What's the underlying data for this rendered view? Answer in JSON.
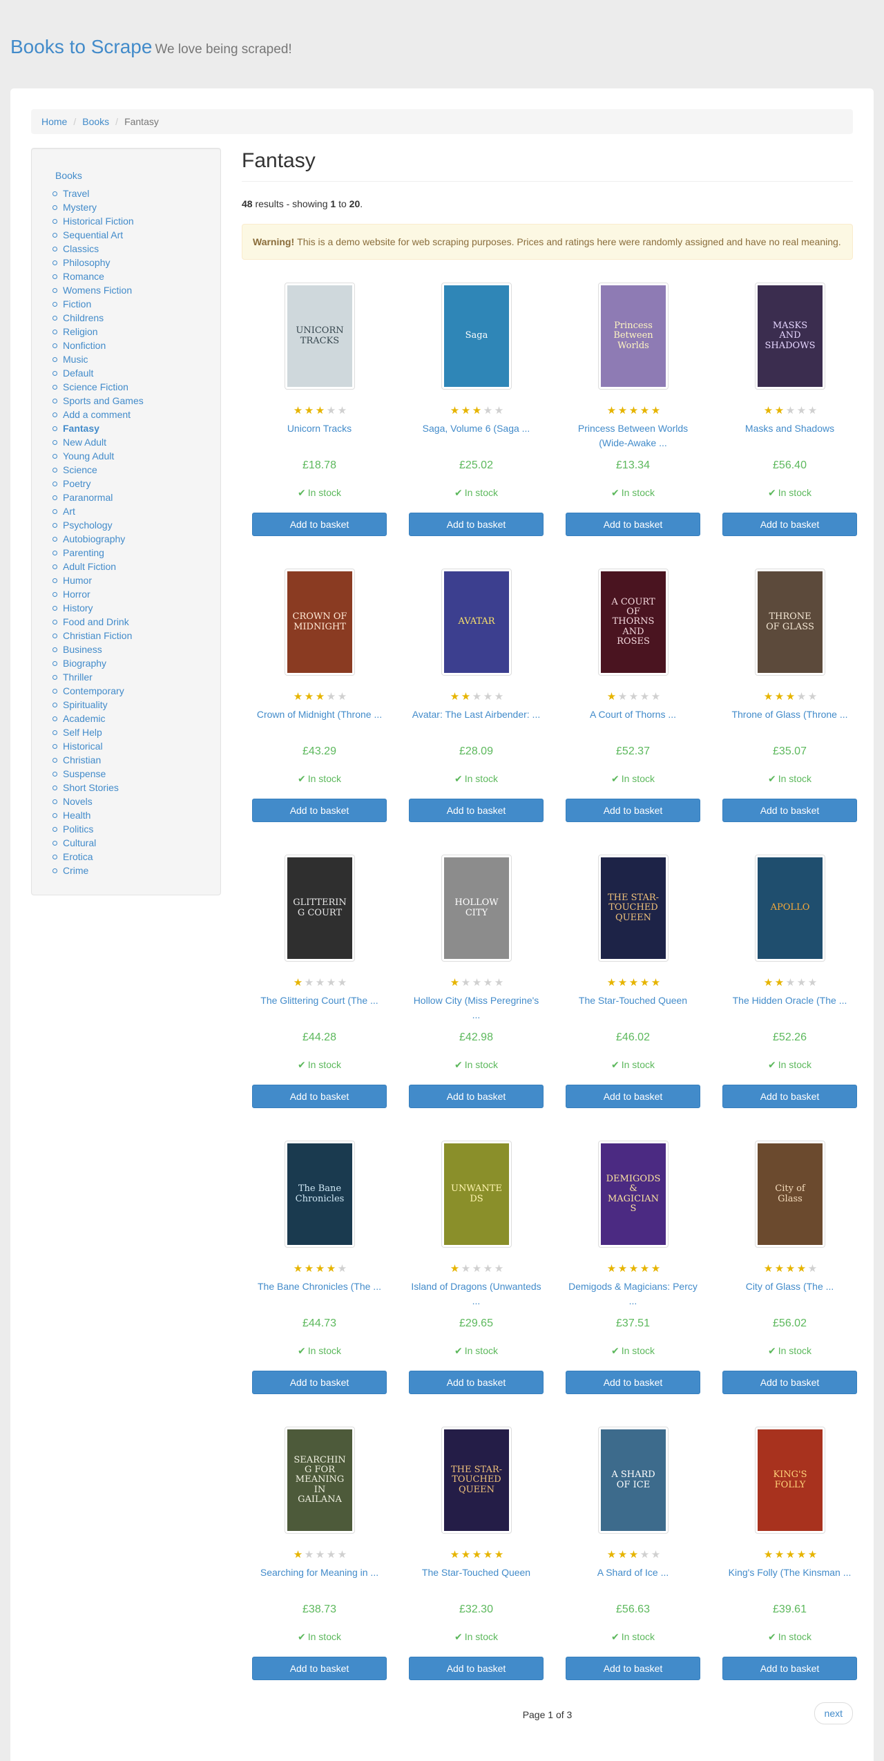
{
  "site": {
    "name": "Books to Scrape",
    "tagline": "We love being scraped!"
  },
  "breadcrumb": {
    "home": "Home",
    "books": "Books",
    "current": "Fantasy",
    "separator": "/"
  },
  "sidebar": {
    "top": "Books",
    "active": "Fantasy",
    "categories": [
      "Travel",
      "Mystery",
      "Historical Fiction",
      "Sequential Art",
      "Classics",
      "Philosophy",
      "Romance",
      "Womens Fiction",
      "Fiction",
      "Childrens",
      "Religion",
      "Nonfiction",
      "Music",
      "Default",
      "Science Fiction",
      "Sports and Games",
      "Add a comment",
      "Fantasy",
      "New Adult",
      "Young Adult",
      "Science",
      "Poetry",
      "Paranormal",
      "Art",
      "Psychology",
      "Autobiography",
      "Parenting",
      "Adult Fiction",
      "Humor",
      "Horror",
      "History",
      "Food and Drink",
      "Christian Fiction",
      "Business",
      "Biography",
      "Thriller",
      "Contemporary",
      "Spirituality",
      "Academic",
      "Self Help",
      "Historical",
      "Christian",
      "Suspense",
      "Short Stories",
      "Novels",
      "Health",
      "Politics",
      "Cultural",
      "Erotica",
      "Crime"
    ]
  },
  "main": {
    "title": "Fantasy",
    "results": {
      "count": "48",
      "text1": " results - showing ",
      "from": "1",
      "to_word": " to ",
      "to": "20",
      "end": "."
    },
    "warning": {
      "label": "Warning!",
      "text": "This is a demo website for web scraping purposes. Prices and ratings here were randomly assigned and have no real meaning."
    }
  },
  "labels": {
    "in_stock": "In stock",
    "add_to_basket": "Add to basket",
    "check_icon": "check-icon"
  },
  "books": [
    {
      "title": "Unicorn Tracks",
      "price": "£18.78",
      "rating": 3,
      "cover_text": "UNICORN TRACKS",
      "cover_bg": "#cfd8dc",
      "cover_fg": "#37474f"
    },
    {
      "title": "Saga, Volume 6 (Saga ...",
      "price": "£25.02",
      "rating": 3,
      "cover_text": "Saga",
      "cover_bg": "#2f86b7",
      "cover_fg": "#ffffff"
    },
    {
      "title": "Princess Between Worlds (Wide-Awake ...",
      "price": "£13.34",
      "rating": 5,
      "cover_text": "Princess Between Worlds",
      "cover_bg": "#8e7bb4",
      "cover_fg": "#fff6c2"
    },
    {
      "title": "Masks and Shadows",
      "price": "£56.40",
      "rating": 2,
      "cover_text": "MASKS AND SHADOWS",
      "cover_bg": "#3b2d4f",
      "cover_fg": "#e6d6ff"
    },
    {
      "title": "Crown of Midnight (Throne ...",
      "price": "£43.29",
      "rating": 3,
      "cover_text": "CROWN OF MIDNIGHT",
      "cover_bg": "#8a3b22",
      "cover_fg": "#ffe9d6"
    },
    {
      "title": "Avatar: The Last Airbender: ...",
      "price": "£28.09",
      "rating": 2,
      "cover_text": "AVATAR",
      "cover_bg": "#3c3f8f",
      "cover_fg": "#fbe36a"
    },
    {
      "title": "A Court of Thorns ...",
      "price": "£52.37",
      "rating": 1,
      "cover_text": "A COURT OF THORNS AND ROSES",
      "cover_bg": "#4a1420",
      "cover_fg": "#f2d7dc"
    },
    {
      "title": "Throne of Glass (Throne ...",
      "price": "£35.07",
      "rating": 3,
      "cover_text": "THRONE OF GLASS",
      "cover_bg": "#5c4a3b",
      "cover_fg": "#f3e6d3"
    },
    {
      "title": "The Glittering Court (The ...",
      "price": "£44.28",
      "rating": 1,
      "cover_text": "GLITTERING COURT",
      "cover_bg": "#2f2f2f",
      "cover_fg": "#e8e8e8"
    },
    {
      "title": "Hollow City (Miss Peregrine's ...",
      "price": "£42.98",
      "rating": 1,
      "cover_text": "HOLLOW CITY",
      "cover_bg": "#8c8c8c",
      "cover_fg": "#ffffff"
    },
    {
      "title": "The Star-Touched Queen",
      "price": "£46.02",
      "rating": 5,
      "cover_text": "THE STAR-TOUCHED QUEEN",
      "cover_bg": "#1d2347",
      "cover_fg": "#f0c27b"
    },
    {
      "title": "The Hidden Oracle (The ...",
      "price": "£52.26",
      "rating": 2,
      "cover_text": "APOLLO",
      "cover_bg": "#1f4e6e",
      "cover_fg": "#f4a93a"
    },
    {
      "title": "The Bane Chronicles (The ...",
      "price": "£44.73",
      "rating": 4,
      "cover_text": "The Bane Chronicles",
      "cover_bg": "#1a3a4f",
      "cover_fg": "#cfe7f4"
    },
    {
      "title": "Island of Dragons (Unwanteds ...",
      "price": "£29.65",
      "rating": 1,
      "cover_text": "UNWANTEDS",
      "cover_bg": "#8a8f2a",
      "cover_fg": "#fff5b0"
    },
    {
      "title": "Demigods & Magicians: Percy ...",
      "price": "£37.51",
      "rating": 5,
      "cover_text": "DEMIGODS & MAGICIANS",
      "cover_bg": "#4b2a82",
      "cover_fg": "#fbe3a0"
    },
    {
      "title": "City of Glass (The ...",
      "price": "£56.02",
      "rating": 4,
      "cover_text": "City of Glass",
      "cover_bg": "#6b4a2e",
      "cover_fg": "#f5dcbc"
    },
    {
      "title": "Searching for Meaning in ...",
      "price": "£38.73",
      "rating": 1,
      "cover_text": "SEARCHING FOR MEANING IN GAILANA",
      "cover_bg": "#4d5a3a",
      "cover_fg": "#f0f0e0"
    },
    {
      "title": "The Star-Touched Queen",
      "price": "£32.30",
      "rating": 5,
      "cover_text": "THE STAR-TOUCHED QUEEN",
      "cover_bg": "#241d47",
      "cover_fg": "#f0c27b"
    },
    {
      "title": "A Shard of Ice ...",
      "price": "£56.63",
      "rating": 3,
      "cover_text": "A SHARD OF ICE",
      "cover_bg": "#3d6b8c",
      "cover_fg": "#ffffff"
    },
    {
      "title": "King's Folly (The Kinsman ...",
      "price": "£39.61",
      "rating": 5,
      "cover_text": "KING'S FOLLY",
      "cover_bg": "#a8321e",
      "cover_fg": "#ffd37a"
    }
  ],
  "pager": {
    "current": "Page 1 of 3",
    "next": "next"
  },
  "colors": {
    "link": "#428bca",
    "price": "#5cb85c",
    "star_on": "#e6b400",
    "star_off": "#d0d0d0",
    "button": "#428bca",
    "warning_bg": "#fcf8e3"
  }
}
